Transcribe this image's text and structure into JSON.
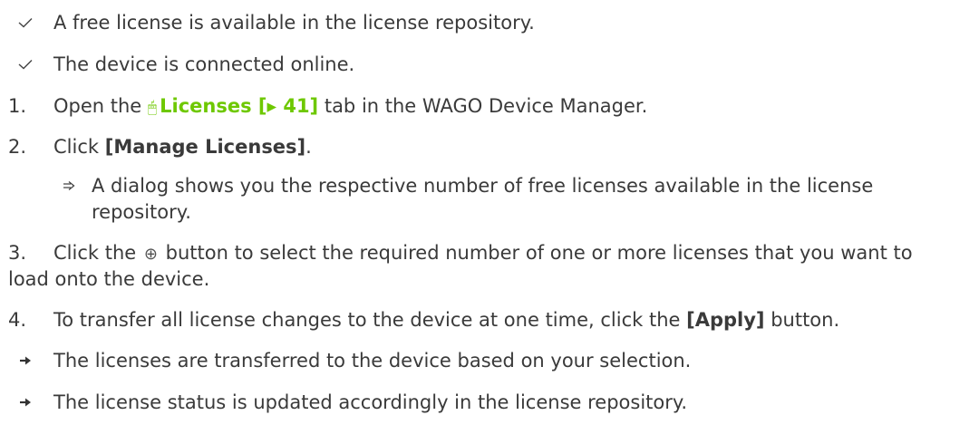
{
  "colors": {
    "text": "#3a3a3a",
    "link": "#6ec800"
  },
  "icons": {
    "check": "check-icon",
    "step_result": "double-arrow-icon",
    "result": "right-arrow-icon",
    "link": "mouse-pointer-icon",
    "add": "circled-plus-icon"
  },
  "prerequisites": [
    "A free license is available in the license repository.",
    "The device is connected online."
  ],
  "steps": {
    "s1": {
      "number": "1.",
      "prefix": "Open the ",
      "link_text": "Licenses [▸ 41]",
      "suffix": " tab in the WAGO Device Manager."
    },
    "s2": {
      "number": "2.",
      "prefix": "Click ",
      "bold": "[Manage Licenses]",
      "suffix": "."
    },
    "s2_result": {
      "line1": "A dialog shows you the respective number of free licenses available in the license",
      "line2": "repository."
    },
    "s3": {
      "number": "3.",
      "prefix": "Click the ",
      "icon_glyph": "⊕",
      "line1_suffix": " button to select the required number of one or more licenses that you want to",
      "line2": "load onto the device."
    },
    "s4": {
      "number": "4.",
      "prefix": "To transfer all license changes to the device at one time, click the ",
      "bold": "[Apply]",
      "suffix": " button."
    }
  },
  "results": [
    "The licenses are transferred to the device based on your selection.",
    "The license status is updated accordingly in the license repository."
  ]
}
